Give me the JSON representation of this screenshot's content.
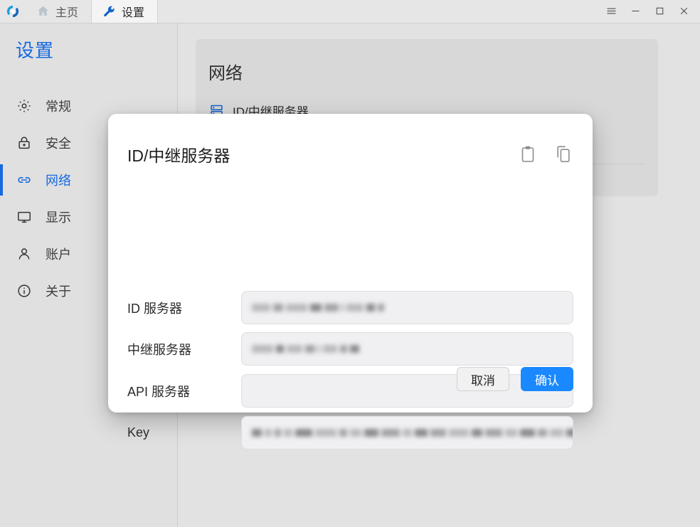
{
  "titlebar": {
    "logo_icon": "app-logo-spiral-icon",
    "tabs": [
      {
        "label": "主页",
        "icon": "home-icon",
        "active": false
      },
      {
        "label": "设置",
        "icon": "wrench-icon",
        "active": true
      }
    ],
    "window_controls": [
      {
        "name": "menu-button",
        "icon": "hamburger-icon"
      },
      {
        "name": "minimize-button",
        "icon": "minimize-icon"
      },
      {
        "name": "maximize-button",
        "icon": "maximize-icon"
      },
      {
        "name": "close-button",
        "icon": "close-icon"
      }
    ]
  },
  "sidebar": {
    "title": "设置",
    "items": [
      {
        "label": "常规",
        "icon": "gear-icon",
        "active": false
      },
      {
        "label": "安全",
        "icon": "lock-icon",
        "active": false
      },
      {
        "label": "网络",
        "icon": "link-icon",
        "active": true
      },
      {
        "label": "显示",
        "icon": "monitor-icon",
        "active": false
      },
      {
        "label": "账户",
        "icon": "user-icon",
        "active": false
      },
      {
        "label": "关于",
        "icon": "info-icon",
        "active": false
      }
    ],
    "accent_color": "#1769e0"
  },
  "main": {
    "card_heading": "网络",
    "entry_label": "ID/中继服务器",
    "entry_icon": "server-stack-icon"
  },
  "dialog": {
    "title": "ID/中继服务器",
    "actions": [
      {
        "name": "paste-button",
        "icon": "clipboard-icon"
      },
      {
        "name": "copy-button",
        "icon": "copy-icon"
      }
    ],
    "fields": [
      {
        "label": "ID 服务器",
        "value": "",
        "placeholder": "",
        "redacted": true
      },
      {
        "label": "中继服务器",
        "value": "",
        "placeholder": "",
        "redacted": true
      },
      {
        "label": "API 服务器",
        "value": "",
        "placeholder": "",
        "redacted": false
      },
      {
        "label": "Key",
        "value": "",
        "placeholder": "",
        "redacted": true
      }
    ],
    "buttons": {
      "cancel": "取消",
      "confirm": "确认"
    },
    "primary_color": "#1a88ff"
  }
}
